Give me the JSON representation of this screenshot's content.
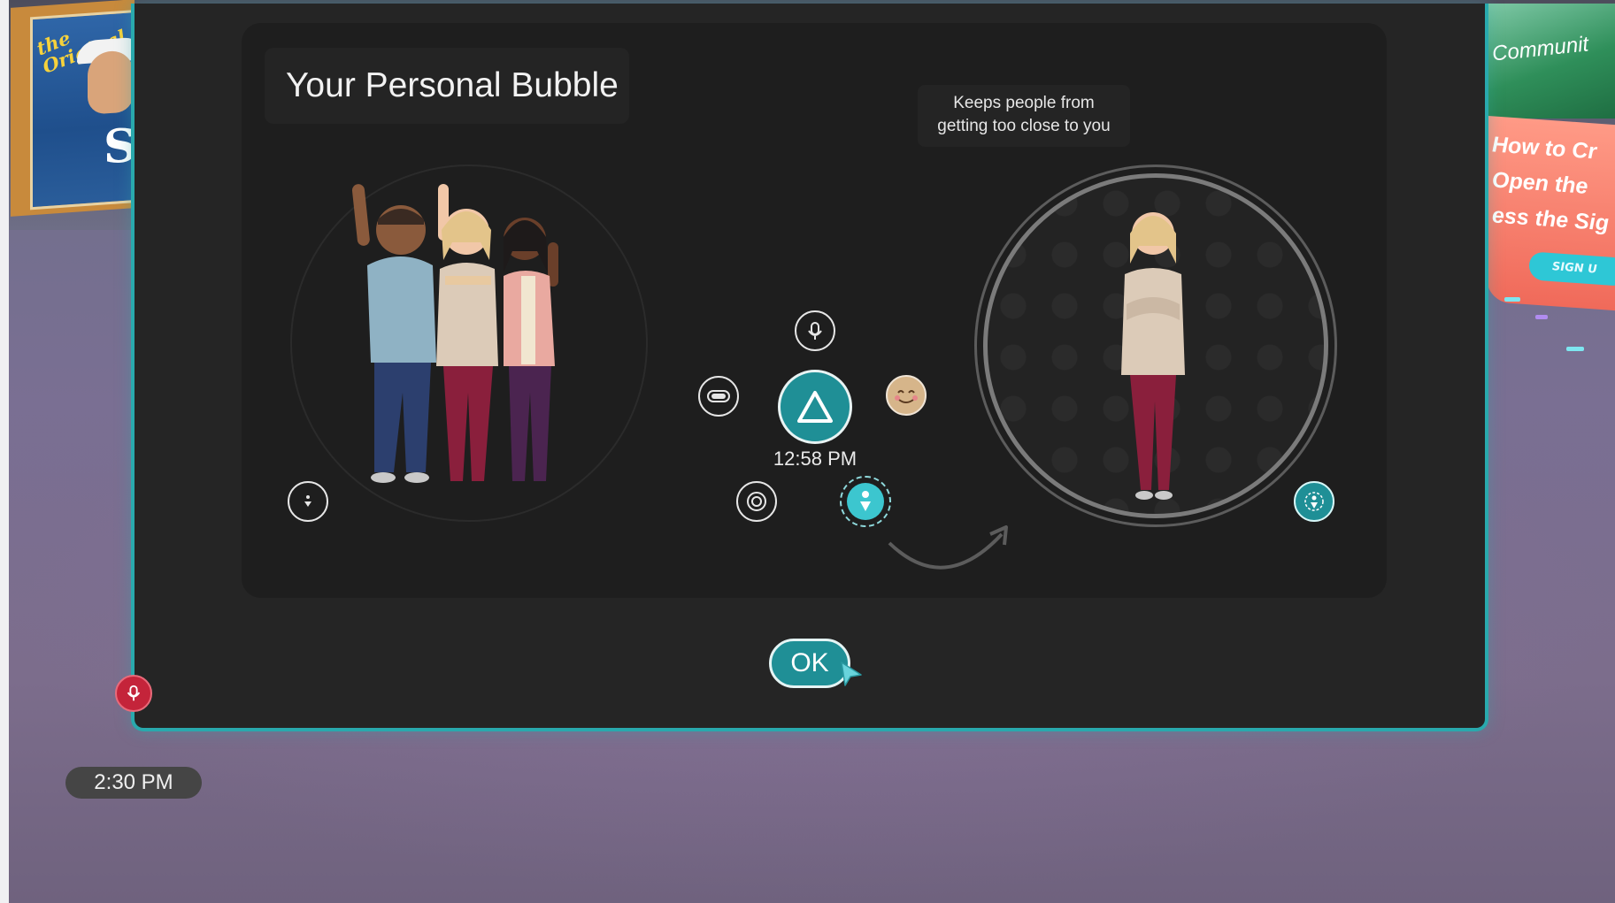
{
  "scene": {
    "left_poster": {
      "text": "the Original",
      "letter": "S"
    },
    "right_poster": {
      "top_text": "Communit",
      "lines": [
        "How to Cr",
        "Open the",
        "ess the Sig"
      ],
      "button_label": "SIGN U"
    }
  },
  "dialog": {
    "title": "Your Personal Bubble",
    "tip": [
      "Keeps people from",
      "getting too close to you"
    ],
    "ok_label": "OK"
  },
  "wrist_menu": {
    "time": "12:58 PM",
    "icons": [
      "microphone-icon",
      "headset-icon",
      "home-triangle-icon",
      "emoji-icon",
      "camera-icon",
      "personal-bubble-icon"
    ]
  },
  "hud": {
    "mic_state": "muted",
    "clock": "2:30 PM"
  },
  "colors": {
    "accent": "#1f8f96",
    "modal_border": "#29a9ad",
    "panel": "#1e1e1e",
    "mic_muted": "#c4243a"
  }
}
